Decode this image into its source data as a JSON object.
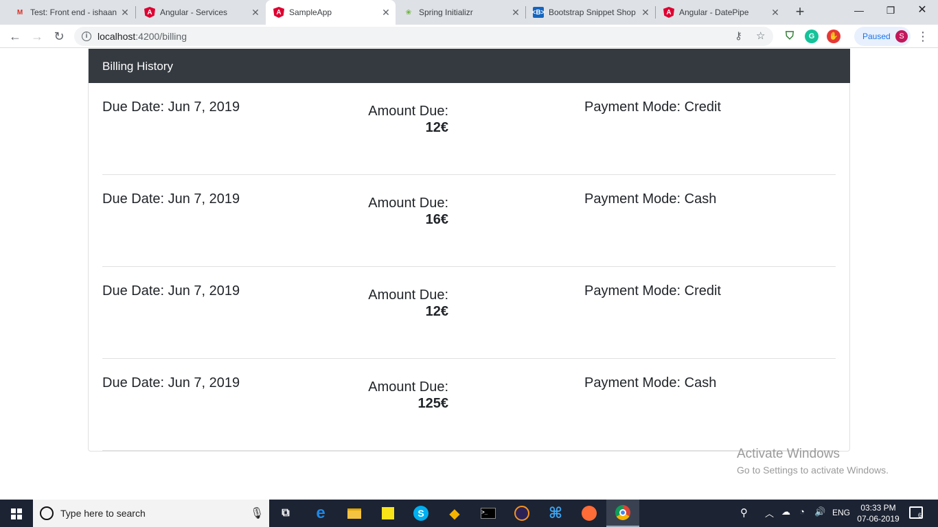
{
  "browser": {
    "tabs": [
      {
        "title": "Test: Front end - ishaan",
        "icon": "gmail-icon"
      },
      {
        "title": "Angular - Services",
        "icon": "angular-icon"
      },
      {
        "title": "SampleApp",
        "icon": "angular-icon",
        "active": true
      },
      {
        "title": "Spring Initializr",
        "icon": "spring-icon"
      },
      {
        "title": "Bootstrap Snippet Shop",
        "icon": "bootstrap-icon"
      },
      {
        "title": "Angular - DatePipe",
        "icon": "angular-icon"
      }
    ],
    "url": "localhost:4200/billing",
    "url_host": "localhost",
    "url_path": ":4200/billing",
    "profile_status": "Paused",
    "profile_initial": "S"
  },
  "page": {
    "header_title": "Billing History",
    "bills": [
      {
        "due_date": "Due Date: Jun 7, 2019",
        "amount_label": "Amount Due:",
        "amount": "12€",
        "payment_mode": "Payment Mode: Credit"
      },
      {
        "due_date": "Due Date: Jun 7, 2019",
        "amount_label": "Amount Due:",
        "amount": "16€",
        "payment_mode": "Payment Mode: Cash"
      },
      {
        "due_date": "Due Date: Jun 7, 2019",
        "amount_label": "Amount Due:",
        "amount": "12€",
        "payment_mode": "Payment Mode: Credit"
      },
      {
        "due_date": "Due Date: Jun 7, 2019",
        "amount_label": "Amount Due:",
        "amount": "125€",
        "payment_mode": "Payment Mode: Cash"
      }
    ]
  },
  "watermark": {
    "line1": "Activate Windows",
    "line2": "Go to Settings to activate Windows."
  },
  "taskbar": {
    "search_placeholder": "Type here to search",
    "language": "ENG",
    "time": "03:33 PM",
    "date": "07-06-2019",
    "notification_count": "6"
  },
  "colors": {
    "card_header_bg": "#343a40",
    "taskbar_bg": "#1c2333",
    "tabstrip_bg": "#dee1e6"
  }
}
